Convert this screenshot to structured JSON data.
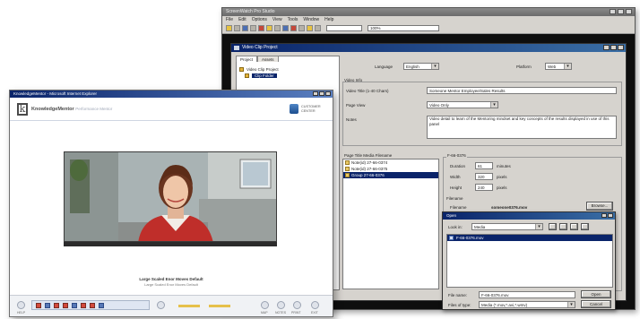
{
  "editor": {
    "title": "ScreenWatch Pro Studio",
    "menu": [
      "File",
      "Edit",
      "Options",
      "View",
      "Tools",
      "Window",
      "Help"
    ],
    "zoom_field": "100%"
  },
  "clip_dialog": {
    "title": "Video Clip Project",
    "tabs": [
      "Project",
      "Assets"
    ],
    "tree": [
      {
        "label": "Video Clip Project",
        "selected": false
      },
      {
        "label": "Clip Folder",
        "selected": true
      }
    ],
    "language_label": "Language",
    "language_value": "English",
    "platform_label": "Platform",
    "platform_value": "Web",
    "video_info_label": "Video Info",
    "video_title_label": "Video Title (1-40 Chars)",
    "video_title_value": "Someone Mentor Employee/Sales Results",
    "page_view_label": "Page View",
    "page_view_value": "Video Only",
    "notes_label": "Notes",
    "notes_value": "Video detail to learn of the Mentoring mindset and key concepts of the results displayed in use of this panel",
    "files_label": "Page Title Media Filename",
    "files": [
      {
        "label": "Note(id) 27-66-0374",
        "selected": false
      },
      {
        "label": "Note(id) 27-66-0375",
        "selected": false
      },
      {
        "label": "Group 27-66-0376",
        "selected": true
      }
    ],
    "clip_group_label": "F-66-0376",
    "duration_label": "Duration",
    "duration_value": "61",
    "duration_unit": "minutes",
    "width_label": "Width",
    "width_value": "320",
    "width_unit": "pixels",
    "height_label": "Height",
    "height_value": "240",
    "height_unit": "pixels",
    "filename_section": "Filename",
    "filename_label": "Filename",
    "filename_value": "someone0376.mov",
    "browse_button": "Browse..."
  },
  "open_dialog": {
    "title": "Open",
    "lookin_label": "Look in:",
    "lookin_value": "Media",
    "files": [
      "F-66-0376.mov"
    ],
    "filename_label": "File name:",
    "filename_value": "F-66-0376.mov",
    "filetype_label": "Files of type:",
    "filetype_value": "Media (*.mov,*.avi,*.wmv)",
    "open_button": "Open",
    "cancel_button": "Cancel"
  },
  "browser": {
    "title": "KnowledgeMentor - Microsoft Internet Explorer",
    "brand": "KnowledgeMentor",
    "brand_sub": "Performance Mentor",
    "header_right_line1": "CUSTOMER",
    "header_right_line2": "CENTER",
    "caption_title": "Large Scaled Enor Moves Default",
    "caption_sub": "Large Scaled Enor Moves Default",
    "footer_labels": [
      "HELP",
      "MAP",
      "NOTES",
      "PRINT",
      "EXIT"
    ],
    "colors": {
      "title_bar": "#0a246a",
      "nav_red": "#d24a3c",
      "nav_blue": "#5778b6"
    }
  }
}
